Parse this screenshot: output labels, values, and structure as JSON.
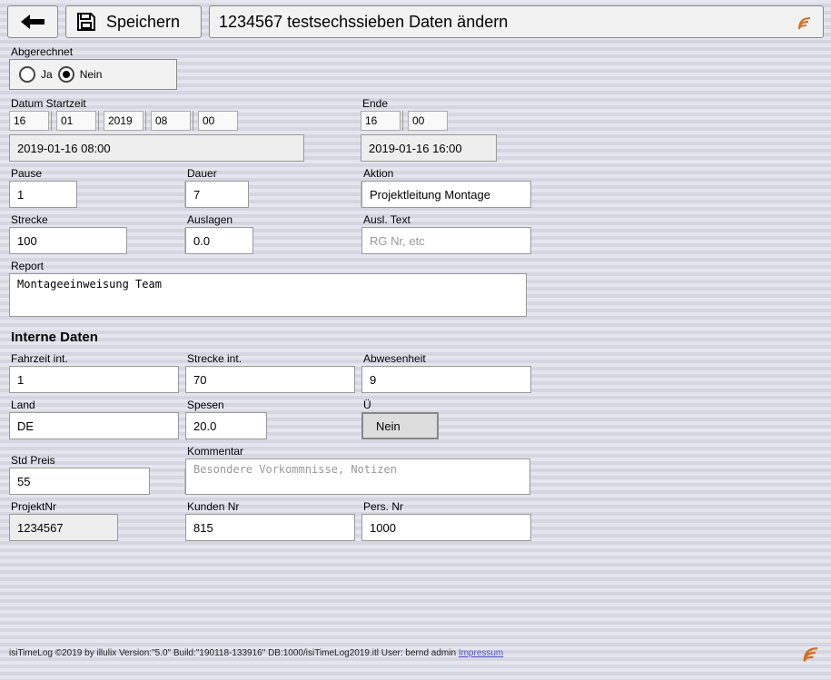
{
  "toolbar": {
    "save_label": "Speichern",
    "title": "1234567 testsechssieben Daten ändern"
  },
  "abgerechnet": {
    "label": "Abgerechnet",
    "ja": "Ja",
    "nein": "Nein",
    "value": "Nein"
  },
  "start": {
    "label": "Datum Startzeit",
    "day": "16",
    "month": "01",
    "year": "2019",
    "hour": "08",
    "min": "00",
    "display": "2019-01-16 08:00"
  },
  "ende": {
    "label": "Ende",
    "hour": "16",
    "min": "00",
    "display": "2019-01-16 16:00"
  },
  "pause": {
    "label": "Pause",
    "value": "1"
  },
  "dauer": {
    "label": "Dauer",
    "value": "7"
  },
  "aktion": {
    "label": "Aktion",
    "value": "Projektleitung Montage"
  },
  "strecke": {
    "label": "Strecke",
    "value": "100"
  },
  "auslagen": {
    "label": "Auslagen",
    "value": "0.0"
  },
  "ausl_text": {
    "label": "Ausl. Text",
    "placeholder": "RG Nr, etc",
    "value": ""
  },
  "report": {
    "label": "Report",
    "value": "Montageeinweisung Team"
  },
  "interne": {
    "title": "Interne Daten",
    "fahrzeit": {
      "label": "Fahrzeit int.",
      "value": "1"
    },
    "strecke": {
      "label": "Strecke int.",
      "value": "70"
    },
    "abwesenheit": {
      "label": "Abwesenheit",
      "value": "9"
    },
    "land": {
      "label": "Land",
      "value": "DE"
    },
    "spesen": {
      "label": "Spesen",
      "value": "20.0"
    },
    "ue": {
      "label": "Ü",
      "value": "Nein"
    },
    "stdpreis": {
      "label": "Std Preis",
      "value": "55"
    },
    "kommentar": {
      "label": "Kommentar",
      "placeholder": "Besondere Vorkommnisse, Notizen",
      "value": ""
    },
    "projektnr": {
      "label": "ProjektNr",
      "value": "1234567"
    },
    "kundennr": {
      "label": "Kunden Nr",
      "value": "815"
    },
    "persnr": {
      "label": "Pers. Nr",
      "value": "1000"
    }
  },
  "footer": {
    "text": "isiTimeLog ©2019 by illulix Version:\"5.0\" Build:\"190118-133916\" DB:1000/isiTimeLog2019.itl User: bernd admin ",
    "impressum": "Impressum"
  }
}
